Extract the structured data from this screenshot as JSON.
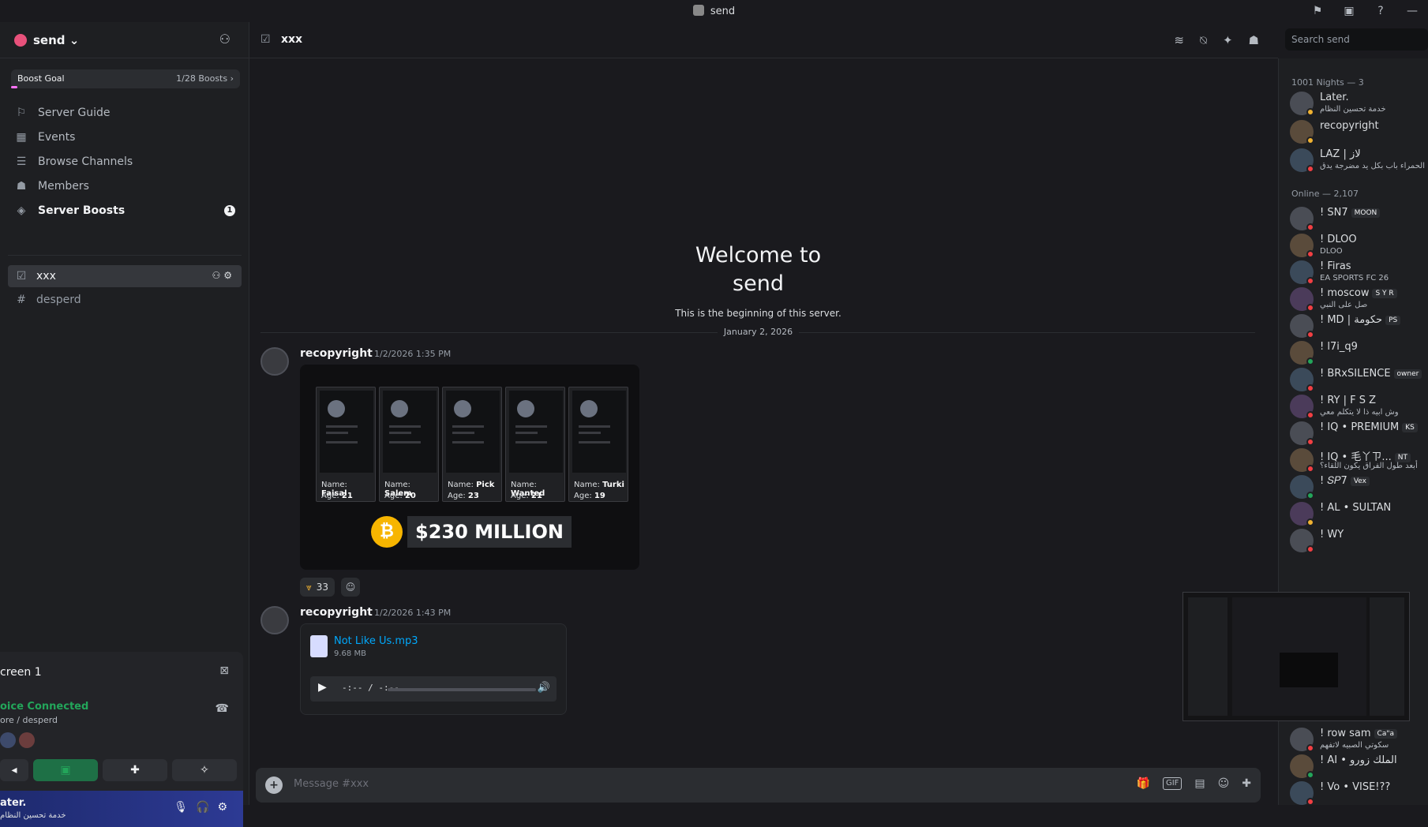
{
  "titlebar": {
    "title": "send"
  },
  "server": {
    "name": "send ⌄"
  },
  "boost_goal": {
    "label": "Boost Goal",
    "progress": "1/28 Boosts ›"
  },
  "nav": [
    {
      "label": "Server Guide"
    },
    {
      "label": "Events"
    },
    {
      "label": "Browse Channels"
    },
    {
      "label": "Members"
    },
    {
      "label": "Server Boosts",
      "badge": "1"
    }
  ],
  "channels": [
    {
      "name": "xxx"
    },
    {
      "name": "desperd"
    }
  ],
  "voice": {
    "title": "creen 1",
    "status": "oice Connected",
    "location": "ore / desperd"
  },
  "user": {
    "name": "ater.",
    "status": "خدمة تحسين النظام"
  },
  "channel_header": {
    "name": "xxx"
  },
  "search": {
    "placeholder": "Search send"
  },
  "welcome": {
    "title_line1": "Welcome to",
    "title_line2": "send",
    "subtitle": "This is the beginning of this server."
  },
  "date_divider": "January 2, 2026",
  "messages": [
    {
      "author": "recopyright",
      "time": "1/2/2026 1:35 PM",
      "image": {
        "profiles": [
          {
            "name_label": "Name:",
            "name": "Faisal",
            "age_label": "Age:",
            "age": "21"
          },
          {
            "name_label": "Name:",
            "name": "Salem",
            "age_label": "Age:",
            "age": "20"
          },
          {
            "name_label": "Name:",
            "name": "Pick",
            "age_label": "Age:",
            "age": "23"
          },
          {
            "name_label": "Name:",
            "name": "Wanted",
            "age_label": "Age:",
            "age": "21"
          },
          {
            "name_label": "Name:",
            "name": "Turki",
            "age_label": "Age:",
            "age": "19"
          }
        ],
        "coin": "₿",
        "amount": "$230 MILLION"
      },
      "reaction_count": "33"
    },
    {
      "author": "recopyright",
      "time": "1/2/2026 1:43 PM",
      "file": {
        "name": "Not Like Us.mp3",
        "size": "9.68 MB",
        "time": "-:-- / -:--",
        "progress": 0.0
      }
    }
  ],
  "composer": {
    "placeholder": "Message #xxx"
  },
  "members": {
    "group1": "1001 Nights — 3",
    "group2": "Online — 2,107",
    "list1": [
      {
        "name": "Later.",
        "sub": "خدمة تحسين النظام",
        "status": "y"
      },
      {
        "name": "recopyright",
        "sub": "",
        "status": "y"
      },
      {
        "name": "LAZ | لاز",
        "sub": "الحمراء باب بكل يد مضرجة يدق",
        "status": "r"
      }
    ],
    "list2": [
      {
        "name": "! SN7",
        "tag": "MOON",
        "sub": "",
        "status": "r"
      },
      {
        "name": "! DLOO",
        "tag": "",
        "sub": "DLOO",
        "status": "r"
      },
      {
        "name": "! Firas",
        "tag": "",
        "sub": "EA SPORTS FC 26",
        "status": "r"
      },
      {
        "name": "! moscow",
        "tag": "S Y R",
        "sub": "صل على النبي",
        "status": "r"
      },
      {
        "name": "! MD | حكومة",
        "tag": "PS",
        "sub": "",
        "status": "r"
      },
      {
        "name": "! l7i_q9",
        "tag": "",
        "sub": "",
        "status": "g"
      },
      {
        "name": "! BRxSILENCE",
        "tag": "owner",
        "sub": "",
        "status": "r"
      },
      {
        "name": "! RY | F S Z",
        "tag": "",
        "sub": "وش ابيه ذا لا يتكلم معي",
        "status": "r"
      },
      {
        "name": "! IQ • PREMIUM",
        "tag": "KS",
        "sub": "",
        "status": "r"
      },
      {
        "name": "! IQ • 毛丫ㄗ...",
        "tag": "NT",
        "sub": "أبعد طول الفراق يكون اللقاء؟",
        "status": "r"
      },
      {
        "name": "! 𝑆𝑃7",
        "tag": "Vex",
        "sub": "",
        "status": "g"
      },
      {
        "name": "! AL • SULTAN",
        "tag": "",
        "sub": "",
        "status": "y"
      },
      {
        "name": "! WY",
        "tag": "",
        "sub": "",
        "status": "r"
      }
    ],
    "list3": [
      {
        "name": "! row sam",
        "tag": "Ca\"a",
        "sub": "سكوتي الصبيه لاتفهم",
        "status": "r"
      },
      {
        "name": "! AI • الملك زورو",
        "tag": "",
        "sub": "",
        "status": "g"
      },
      {
        "name": "! Vo • VISE!??",
        "tag": "",
        "sub": "",
        "status": "r"
      }
    ]
  }
}
